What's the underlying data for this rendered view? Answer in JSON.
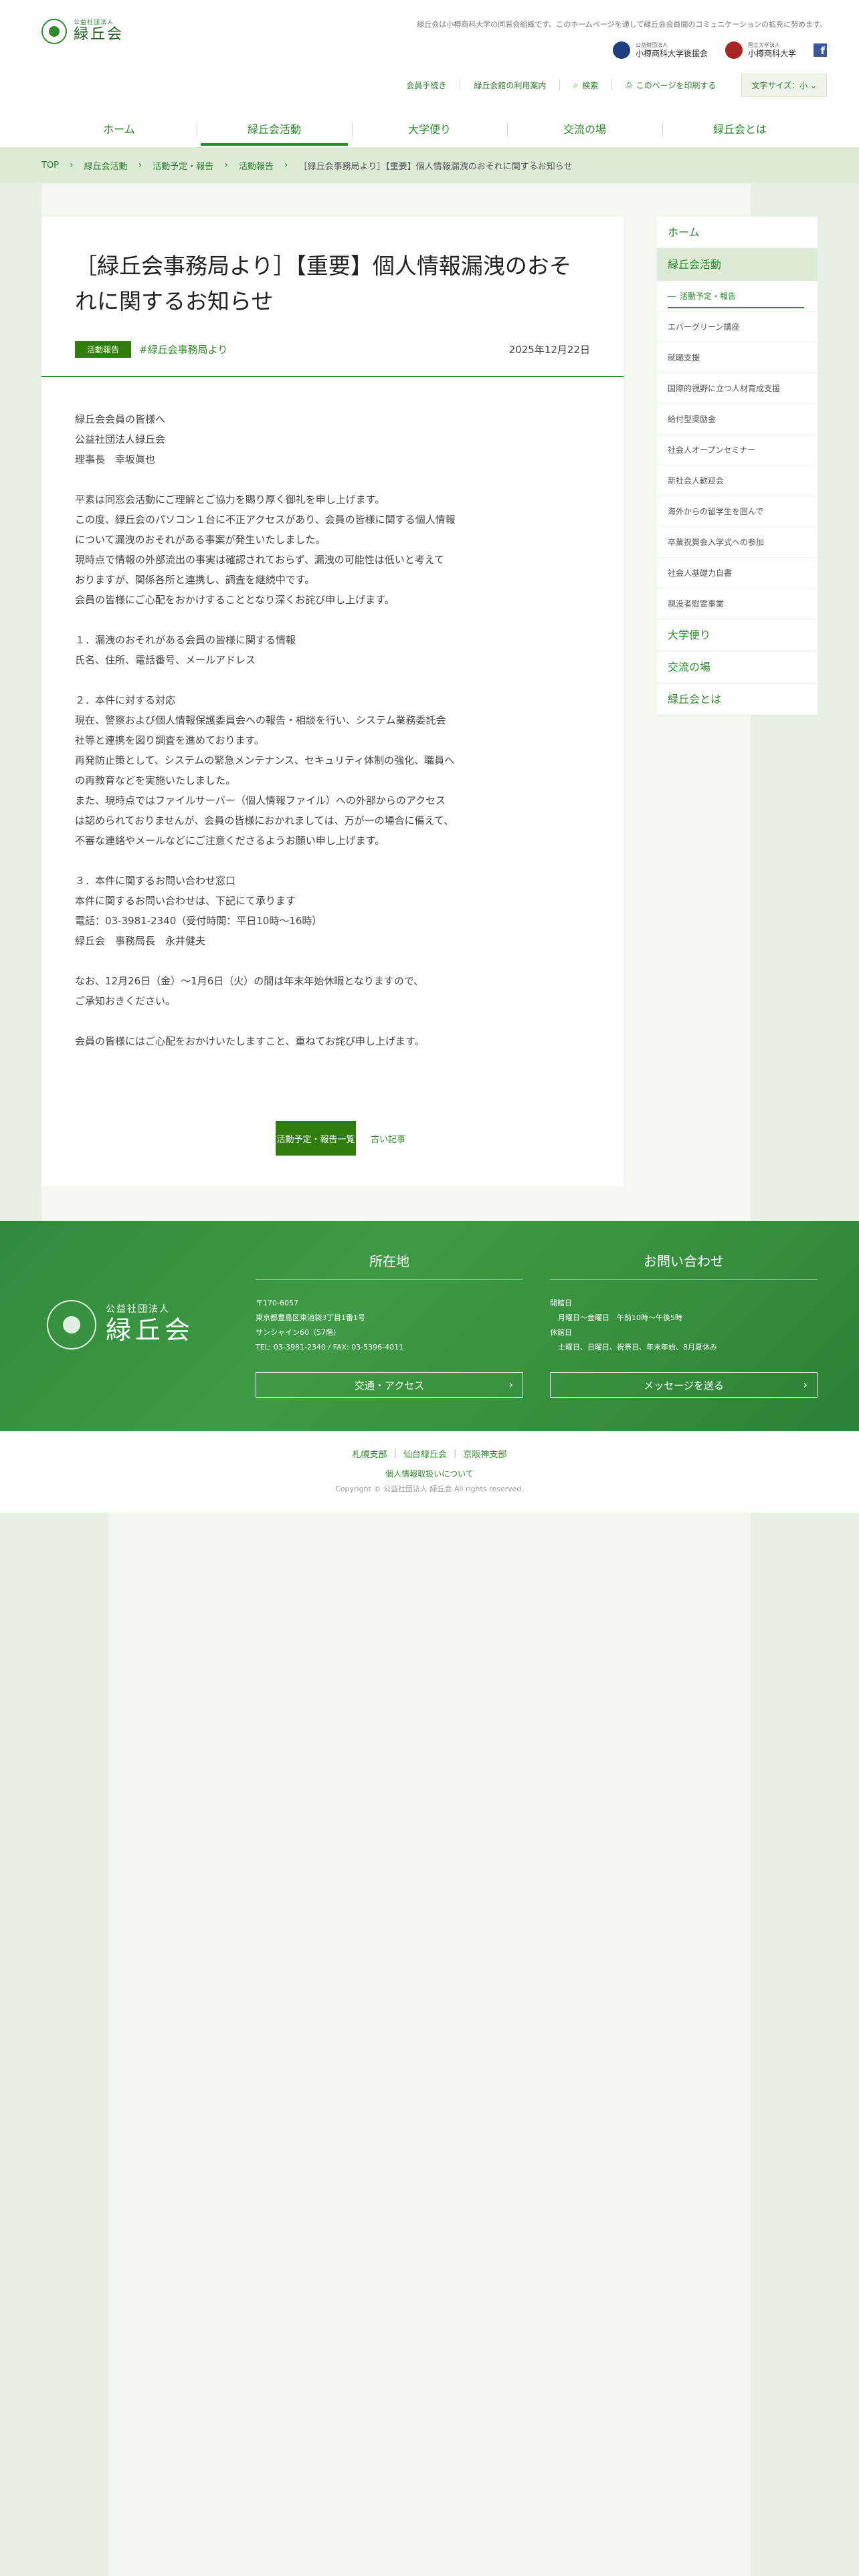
{
  "header": {
    "logo_sub": "公益社団法人",
    "logo_main": "緑丘会",
    "tagline": "緑丘会は小樽商科大学の同窓会組織です。このホームページを通して緑丘会会員間のコミュニケーションの拡充に努めます。",
    "partners": [
      {
        "sub": "公益財団法人",
        "name": "小樽商科大学後援会"
      },
      {
        "sub": "国立大学法人",
        "name": "小樽商科大学"
      }
    ],
    "facebook_label": "f",
    "utility": [
      {
        "label": "会員手続き"
      },
      {
        "label": "緑丘会館の利用案内"
      },
      {
        "label": "検索"
      },
      {
        "label": "このページを印刷する"
      }
    ],
    "fontsize_label": "文字サイズ：小 ⌄"
  },
  "nav": {
    "items": [
      {
        "label": "ホーム"
      },
      {
        "label": "緑丘会活動"
      },
      {
        "label": "大学便り"
      },
      {
        "label": "交流の場"
      },
      {
        "label": "緑丘会とは"
      }
    ]
  },
  "breadcrumb": {
    "items": [
      "TOP",
      "緑丘会活動",
      "活動予定・報告",
      "活動報告"
    ],
    "current": "［緑丘会事務局より］【重要】個人情報漏洩のおそれに関するお知らせ"
  },
  "article": {
    "title": "［緑丘会事務局より］【重要】個人情報漏洩のおそれに関するお知らせ",
    "category": "活動報告",
    "tag": "#緑丘会事務局より",
    "date": "2025年12月22日",
    "paragraphs": [
      [
        "緑丘会会員の皆様へ",
        "公益社団法人緑丘会",
        "理事長　幸坂眞也"
      ],
      [
        "平素は同窓会活動にご理解とご協力を賜り厚く御礼を申し上げます。",
        "この度、緑丘会のパソコン１台に不正アクセスがあり、会員の皆様に関する個人情報",
        "について漏洩のおそれがある事案が発生いたしました。",
        "現時点で情報の外部流出の事実は確認されておらず、漏洩の可能性は低いと考えて",
        "おりますが、関係各所と連携し、調査を継続中です。",
        "会員の皆様にご心配をおかけすることとなり深くお詫び申し上げます。"
      ],
      [
        "１．漏洩のおそれがある会員の皆様に関する情報",
        "氏名、住所、電話番号、メールアドレス"
      ],
      [
        "２．本件に対する対応",
        "現在、警察および個人情報保護委員会への報告・相談を行い、システム業務委託会",
        "社等と連携を図り調査を進めております。",
        "再発防止策として、システムの緊急メンテナンス、セキュリティ体制の強化、職員へ",
        "の再教育などを実施いたしました。",
        "また、現時点ではファイルサーバー（個人情報ファイル）への外部からのアクセス",
        "は認められておりませんが、会員の皆様におかれましては、万が一の場合に備えて、",
        "不審な連絡やメールなどにご注意くださるようお願い申し上げます。"
      ],
      [
        "３．本件に関するお問い合わせ窓口",
        "本件に関するお問い合わせは、下記にて承ります",
        "電話：03-3981-2340（受付時間：平日10時〜16時）",
        "緑丘会　事務局長　永井健夫"
      ],
      [
        "なお、12月26日（金）〜1月6日（火）の間は年末年始休暇となりますので、",
        "ご承知おきください。"
      ],
      [
        "会員の皆様にはご心配をおかけいたしますこと、重ねてお詫び申し上げます。"
      ]
    ],
    "pager_next": "活動予定・報告一覧",
    "pager_old": "古い記事"
  },
  "sidebar": {
    "top_items": [
      {
        "label": "ホーム"
      },
      {
        "label": "緑丘会活動"
      }
    ],
    "sub_items": [
      {
        "label": "活動予定・報告"
      },
      {
        "label": "エバーグリーン講座"
      },
      {
        "label": "就職支援"
      },
      {
        "label": "国際的視野に立つ人材育成支援"
      },
      {
        "label": "給付型奨励金"
      },
      {
        "label": "社会人オープンセミナー"
      },
      {
        "label": "新社会人歓迎会"
      },
      {
        "label": "海外からの留学生を囲んで"
      },
      {
        "label": "卒業祝賀会入学式への参加"
      },
      {
        "label": "社会人基礎力自書"
      },
      {
        "label": "親没者慰霊事業"
      }
    ],
    "bottom_items": [
      {
        "label": "大学便り"
      },
      {
        "label": "交流の場"
      },
      {
        "label": "緑丘会とは"
      }
    ]
  },
  "footer": {
    "logo_sub": "公益社団法人",
    "logo_main": "緑丘会",
    "location_head": "所在地",
    "contact_head": "お問い合わせ",
    "address": [
      "〒170-6057",
      "東京都豊島区東池袋3丁目1番1号",
      "サンシャイン60（57階）",
      "TEL: 03-3981-2340 / FAX: 03-5396-4011"
    ],
    "hours": [
      "開館日",
      "月曜日〜金曜日　午前10時〜午後5時",
      "休館日",
      "土曜日、日曜日、祝祭日、年末年始、8月夏休み"
    ],
    "access_btn": "交通・アクセス",
    "message_btn": "メッセージを送る",
    "chev": "›"
  },
  "bottom": {
    "branches": [
      "札幌支部",
      "仙台緑丘会",
      "京阪神支部"
    ],
    "privacy": "個人情報取扱いについて",
    "copyright": "Copyright © 公益社団法人 緑丘会 All rights reserved."
  },
  "colors": {
    "accent": "#2e8b2e",
    "badge": "#2e7d0e",
    "breadcrumb_bg": "#dcebd5"
  }
}
